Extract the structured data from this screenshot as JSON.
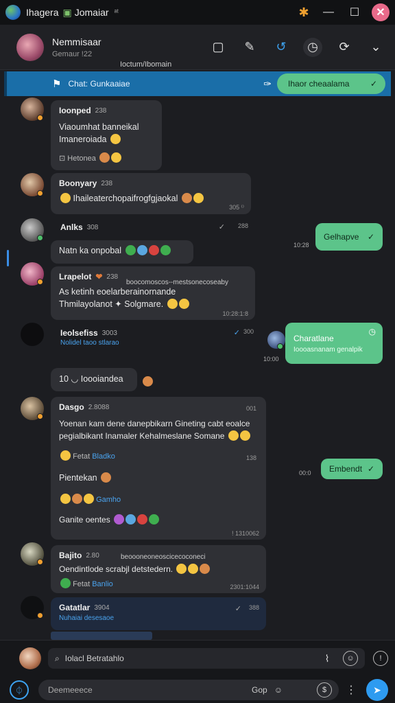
{
  "window": {
    "title": "Ihagera",
    "title_extra": "Jomaiar",
    "title_suffix": "ᵃᵗ"
  },
  "header": {
    "name": "Nemmisaar",
    "subtitle": "Gemaur !22",
    "below": "Ioctum/Ibomain"
  },
  "banner": {
    "text": "Chat: Gunkaaiae",
    "pill_label": "Ihaor cheaalama"
  },
  "messages": [
    {
      "name": "Ioonped",
      "badge": "238",
      "lines": [
        "Viaoumhat banneikal",
        "Imaneroiada"
      ],
      "sub": "Hetonea"
    },
    {
      "name": "Boonyary",
      "badge": "238",
      "lines": [
        "Ihaileaterchopaifrogfgjaokal"
      ],
      "time": "305 ⁽⁾"
    },
    {
      "name": "Anlks",
      "badge": "308",
      "time": "288"
    },
    {
      "lines": [
        "Natn ka onpobal"
      ]
    },
    {
      "name": "Lrapelot",
      "badge": "238",
      "preview": "boocomoscos--mestsonecoseaby",
      "lines": [
        "As ketinh eoelarberainornande",
        "Thmilayolanot ✦ Solgmare."
      ],
      "time": "10:28:1:8"
    },
    {
      "name": "Ieolsefiss",
      "badge": "3003",
      "sub": "Nolidel taoo stlarao",
      "time": "300"
    },
    {
      "lines": [
        "10 ◡ Ioooiandea"
      ]
    },
    {
      "name": "Dasgo",
      "badge": "2.8088",
      "time": "001",
      "lines": [
        "Yoenan kam dene danepbikarn Gineting cabt eoalce",
        "pegialbikant Inamaler Kehalmeslane Somane"
      ],
      "time2": "138",
      "sub": "Fetat",
      "link": "Bladko",
      "line3": "Pientekan",
      "link2": "Gamho",
      "line4": "Ganite oentes",
      "time3": "! 1310062"
    },
    {
      "name": "Bajito",
      "badge": "2.80",
      "preview": "beoooneoneoscicecoconeci",
      "lines": [
        "Oendintlode scrabjl detstedern."
      ],
      "sub": "Fetat",
      "link": "Banlio",
      "time": "2301:1044"
    },
    {
      "name": "Gatatlar",
      "badge": "3904",
      "sub": "Nuhaiai desesaoe",
      "time": "388"
    }
  ],
  "outgoing": [
    {
      "text": "Gelhapve",
      "time": "10:28"
    },
    {
      "title": "Charatlane",
      "text": "Ioooasnanam genalpik",
      "time": "10:00"
    },
    {
      "text": "Embendt",
      "time": "00:0"
    }
  ],
  "composer": {
    "reply_placeholder": "Iolacl Betratahlo",
    "input_placeholder": "Deemeeece",
    "input_right_label": "Gop"
  }
}
